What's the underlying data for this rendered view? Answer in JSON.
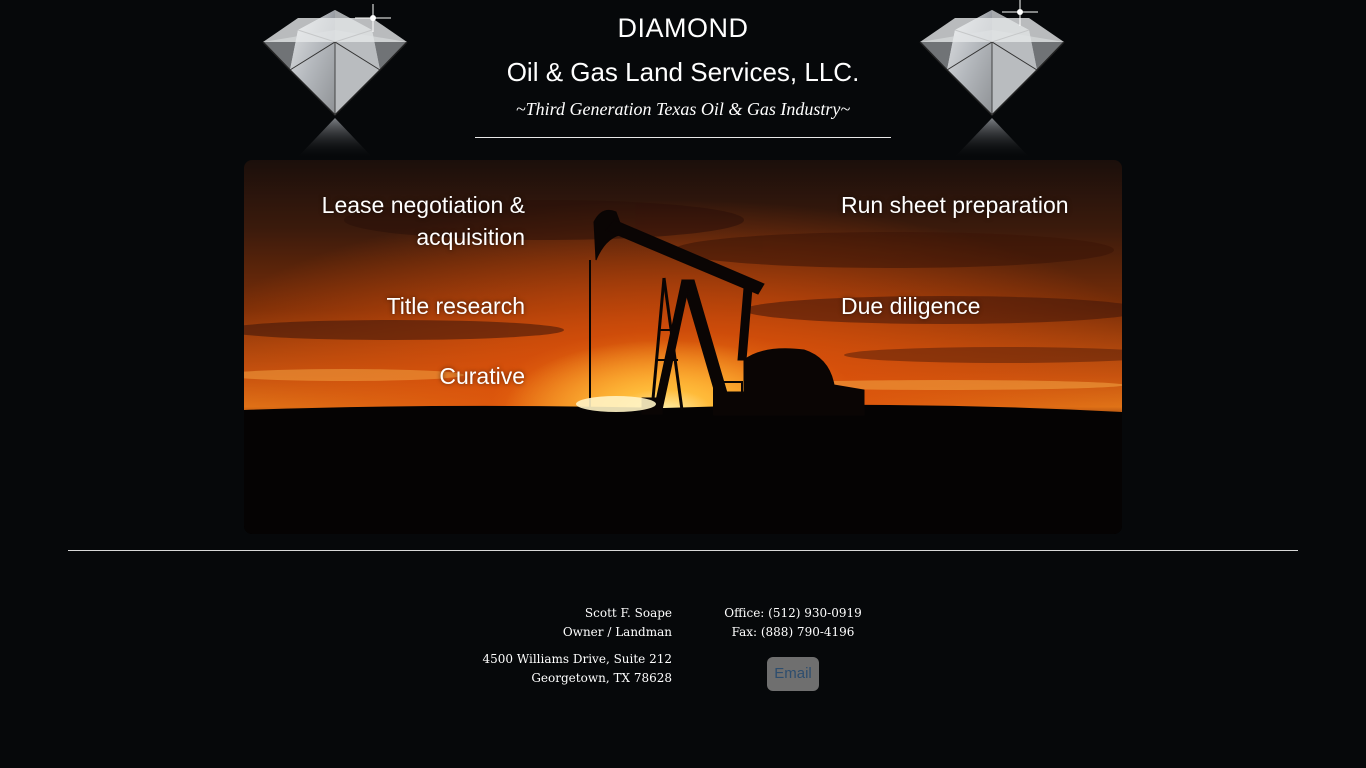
{
  "header": {
    "company_line1": "DIAMOND",
    "company_line2": "Oil & Gas Land Services, LLC.",
    "tagline": "~Third Generation Texas Oil & Gas Industry~"
  },
  "services": {
    "left": [
      "Lease negotiation & acquisition",
      "Title research",
      "Curative"
    ],
    "right": [
      "Run sheet preparation",
      "Due diligence"
    ]
  },
  "contact": {
    "name": "Scott F. Soape",
    "title": "Owner / Landman",
    "address_line1": "4500 Williams Drive, Suite 212",
    "address_line2": "Georgetown, TX 78628",
    "office": "Office: (512) 930-0919",
    "fax": "Fax: (888) 790-4196",
    "email_label": "Email"
  },
  "icons": {
    "diamond": "diamond-icon",
    "pumpjack": "pumpjack-silhouette"
  },
  "colors": {
    "background": "#06080a",
    "sunset_orange": "#e07a1a",
    "email_text": "#2d4d6e",
    "email_button": "#6f6f6f"
  }
}
